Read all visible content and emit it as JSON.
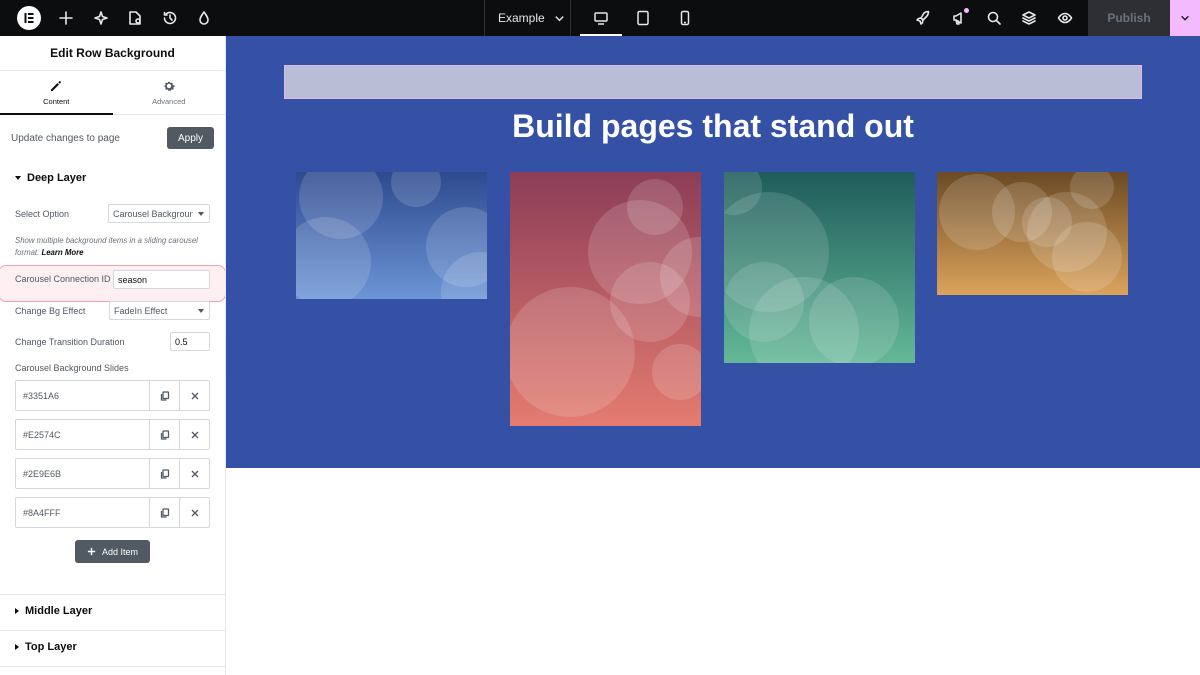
{
  "topbar": {
    "site_name": "Example",
    "publish_label": "Publish",
    "icons": [
      "elementor-logo-icon",
      "plus-icon",
      "sparkle-icon",
      "page-settings-icon",
      "history-icon",
      "theme-icon",
      "site-name-chevron-icon",
      "desktop-icon",
      "tablet-icon",
      "mobile-icon",
      "rocket-icon",
      "notifications-icon",
      "search-icon",
      "structure-icon",
      "preview-eye-icon",
      "publish-options-chevron-icon"
    ]
  },
  "panel": {
    "title": "Edit Row Background",
    "tabs": [
      {
        "label": "Content",
        "icon": "pencil-icon",
        "active": true
      },
      {
        "label": "Advanced",
        "icon": "gear-icon",
        "active": false
      }
    ],
    "update_text": "Update changes to page",
    "apply_label": "Apply",
    "deep_layer": {
      "heading": "Deep Layer",
      "select_option_label": "Select Option",
      "select_option_value": "Carousel Background",
      "description": "Show multiple background items in a sliding carousel format.",
      "learn_more": "Learn More",
      "connection_id_label": "Carousel Connection ID",
      "connection_id_value": "season",
      "change_bg_effect_label": "Change Bg Effect",
      "change_bg_effect_value": "FadeIn Effect",
      "transition_duration_label": "Change Transition Duration",
      "transition_duration_value": "0.5",
      "slides_label": "Carousel Background Slides",
      "slides": [
        "#3351A6",
        "#E2574C",
        "#2E9E6B",
        "#8A4FFF"
      ],
      "add_item_label": "Add Item"
    },
    "middle_layer": "Middle Layer",
    "top_layer": "Top Layer"
  },
  "canvas": {
    "hero_title": "Build pages that stand out",
    "colors": {
      "hero_bg": "#3551a6",
      "card_blue": [
        "#2e4a8f",
        "#6c95d6"
      ],
      "card_red": [
        "#8c3d58",
        "#e47c70"
      ],
      "card_green": [
        "#1f5c5b",
        "#64b897"
      ],
      "card_gold": [
        "#6b4a24",
        "#dca35c"
      ]
    }
  },
  "theme": {
    "accent": "#f3bafd",
    "dark": "#0c0d0e"
  }
}
